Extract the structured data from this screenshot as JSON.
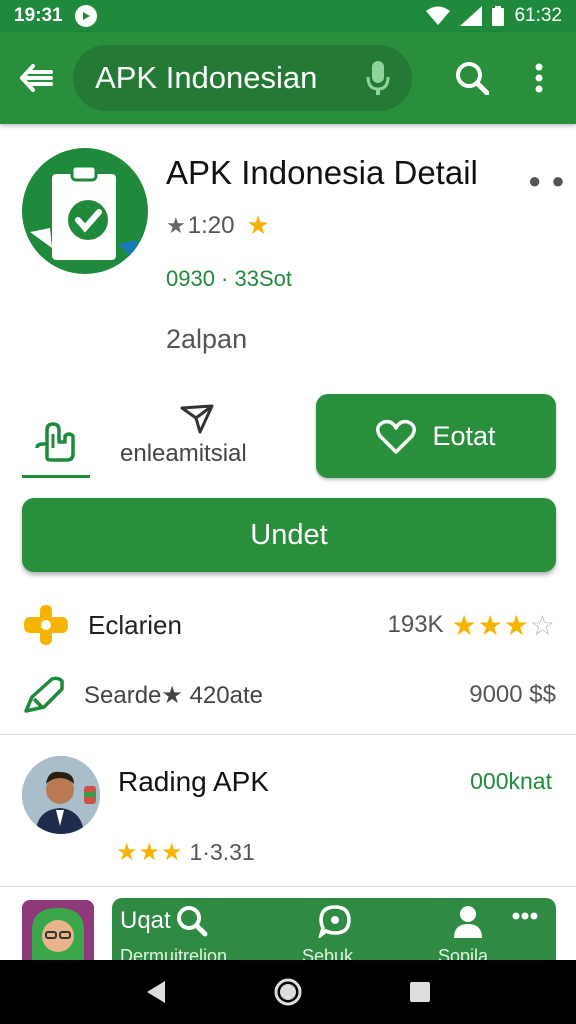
{
  "status_bar": {
    "time": "19:31",
    "battery_text": "61:32"
  },
  "app_bar": {
    "search_query": "APK Indonesian",
    "icons": [
      "back-arrow-icon",
      "mic-icon",
      "search-icon",
      "more-vert-icon"
    ]
  },
  "app_header": {
    "title": "APK Indonesia Detail",
    "rating": "1:20",
    "size_line": "0930 · 33Sot",
    "subtitle": "2alpan"
  },
  "actions": {
    "share_label": "enleamitsial",
    "favorite_label": "Eotat",
    "install_label": "Undet"
  },
  "stats": [
    {
      "label": "Eclarien",
      "value": "193K",
      "stars_filled": 3,
      "stars_total": 4
    },
    {
      "label": "Searde★ 420ate",
      "value": "9000 $$"
    }
  ],
  "related": {
    "title": "Rading APK",
    "price": "000knat",
    "rating": "1·3.31",
    "stars_filled": 3
  },
  "bottom_panel": {
    "items": [
      {
        "label": "Uqat",
        "sub": "Dermuitrelion"
      },
      {
        "label": "",
        "sub": "Sebuk"
      },
      {
        "label": "",
        "sub": "Sopila"
      }
    ]
  },
  "colors": {
    "primary_green": "#2a8f3d",
    "dark_green": "#1f8a3c",
    "star_yellow": "#f4b400"
  }
}
